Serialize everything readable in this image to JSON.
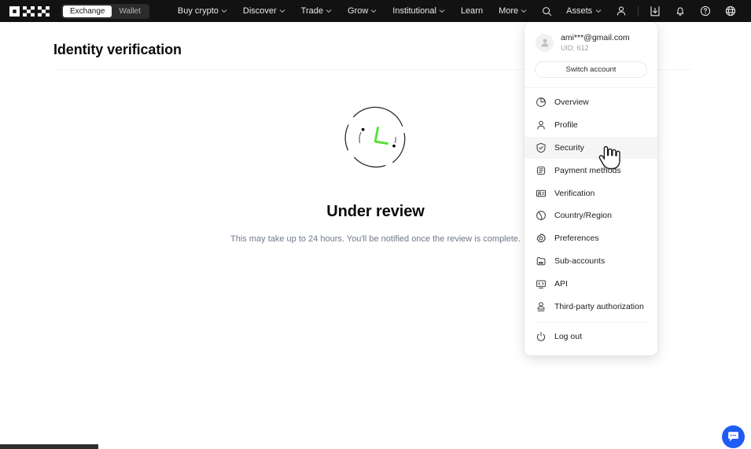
{
  "brand": {
    "name": "OKX",
    "accent": "#1e5cf5",
    "spinner_accent": "#5ce03e"
  },
  "topnav": {
    "segments": [
      {
        "label": "Exchange",
        "active": true
      },
      {
        "label": "Wallet",
        "active": false
      }
    ],
    "links": [
      {
        "label": "Buy crypto",
        "caret": true,
        "icon": "chevron-down-icon"
      },
      {
        "label": "Discover",
        "caret": true,
        "icon": "chevron-down-icon"
      },
      {
        "label": "Trade",
        "caret": true,
        "icon": "chevron-down-icon"
      },
      {
        "label": "Grow",
        "caret": true,
        "icon": "chevron-down-icon"
      },
      {
        "label": "Institutional",
        "caret": true,
        "icon": "chevron-down-icon"
      },
      {
        "label": "Learn",
        "caret": false,
        "icon": ""
      },
      {
        "label": "More",
        "caret": true,
        "icon": "chevron-down-icon"
      }
    ],
    "right": {
      "search_icon": "search-icon",
      "assets_label": "Assets",
      "assets_icon": "chevron-down-icon",
      "account_icon": "user-icon",
      "download_icon": "download-icon",
      "notification_icon": "bell-icon",
      "help_icon": "question-circle-icon",
      "language_icon": "globe-icon"
    }
  },
  "main": {
    "page_title": "Identity verification",
    "status_title": "Under review",
    "status_subtitle": "This may take up to 24 hours. You'll be notified once the review is complete.",
    "spinner_name": "clock-spinner"
  },
  "dropdown": {
    "account": {
      "email": "ami***@gmail.com",
      "uid": "UID: 612",
      "avatar_icon": "user-avatar-icon"
    },
    "switch_account_label": "Switch account",
    "items": [
      {
        "label": "Overview",
        "icon": "pie-chart-icon",
        "active": false
      },
      {
        "label": "Profile",
        "icon": "user-icon",
        "active": false
      },
      {
        "label": "Security",
        "icon": "shield-check-icon",
        "active": true
      },
      {
        "label": "Payment methods",
        "icon": "wallet-icon",
        "active": false
      },
      {
        "label": "Verification",
        "icon": "id-card-icon",
        "active": false
      },
      {
        "label": "Country/Region",
        "icon": "globe-icon",
        "active": false
      },
      {
        "label": "Preferences",
        "icon": "gear-icon",
        "active": false
      },
      {
        "label": "Sub-accounts",
        "icon": "sub-accounts-icon",
        "active": false
      },
      {
        "label": "API",
        "icon": "code-window-icon",
        "active": false
      },
      {
        "label": "Third-party authorization",
        "icon": "user-key-icon",
        "active": false
      }
    ],
    "logout": {
      "label": "Log out",
      "icon": "power-icon"
    }
  },
  "chat": {
    "icon": "chat-bubble-icon",
    "label": ""
  }
}
